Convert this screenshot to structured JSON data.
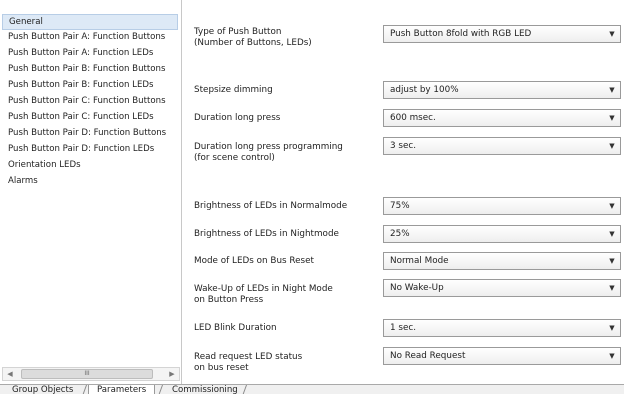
{
  "sidebar": {
    "items": [
      {
        "label": "General"
      },
      {
        "label": "Push Button Pair A: Function Buttons"
      },
      {
        "label": "Push Button Pair A: Function LEDs"
      },
      {
        "label": "Push Button Pair B: Function Buttons"
      },
      {
        "label": "Push Button Pair B: Function LEDs"
      },
      {
        "label": "Push Button Pair C: Function Buttons"
      },
      {
        "label": "Push Button Pair C: Function LEDs"
      },
      {
        "label": "Push Button Pair D: Function Buttons"
      },
      {
        "label": "Push Button Pair D: Function LEDs"
      },
      {
        "label": "Orientation LEDs"
      },
      {
        "label": "Alarms"
      }
    ],
    "scrollbar": {
      "left_icon": "scroll-left-arrow-icon",
      "right_icon": "scroll-right-arrow-icon",
      "thumb_grip": "III"
    }
  },
  "params": [
    {
      "label": "Type of Push Button\n(Number of Buttons, LEDs)",
      "value": "Push Button 8fold with RGB LED"
    },
    {
      "label": "Stepsize dimming",
      "value": "adjust by 100%"
    },
    {
      "label": "Duration long press",
      "value": "600 msec."
    },
    {
      "label": "Duration long press programming\n(for scene control)",
      "value": "3 sec."
    },
    {
      "label": "Brightness of LEDs in Normalmode",
      "value": "75%"
    },
    {
      "label": "Brightness of LEDs in Nightmode",
      "value": "25%"
    },
    {
      "label": "Mode of LEDs on Bus Reset",
      "value": "Normal Mode"
    },
    {
      "label": "Wake-Up of LEDs in Night Mode\non Button Press",
      "value": "No Wake-Up"
    },
    {
      "label": "LED Blink Duration",
      "value": "1 sec."
    },
    {
      "label": "Read request LED status\non bus reset",
      "value": "No Read Request"
    }
  ],
  "tabs": [
    {
      "label": "Group Objects"
    },
    {
      "label": "Parameters"
    },
    {
      "label": "Commissioning"
    }
  ],
  "colors": {
    "selected_bg": "#dde9f6",
    "border": "#9a9a9a"
  }
}
